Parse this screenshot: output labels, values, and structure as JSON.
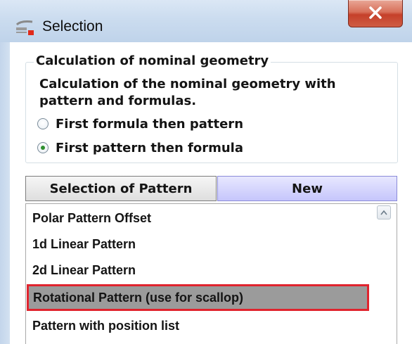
{
  "window": {
    "title": "Selection",
    "icon": "selection-app-icon",
    "close_icon": "close-icon"
  },
  "nominal_geometry": {
    "group_title": "Calculation of nominal geometry",
    "description_line1": "Calculation of the nominal geometry with",
    "description_line2": "pattern and formulas.",
    "options": [
      {
        "label": "First formula then pattern",
        "selected": false
      },
      {
        "label": "First pattern then formula",
        "selected": true
      }
    ]
  },
  "tabs": {
    "selection_label": "Selection of Pattern",
    "new_label": "New"
  },
  "pattern_list": {
    "items": [
      {
        "label": "Polar Pattern Offset",
        "selected": false
      },
      {
        "label": "1d Linear Pattern",
        "selected": false
      },
      {
        "label": "2d Linear Pattern",
        "selected": false
      },
      {
        "label": "Rotational Pattern (use for scallop)",
        "selected": true
      },
      {
        "label": "Pattern with position list",
        "selected": false
      }
    ],
    "scroll_icon": "scroll-up-arrow-icon"
  },
  "colors": {
    "selected_row_bg": "#9b9b9b",
    "highlight_border": "#e0242e",
    "new_tab_bg": "#c6c6fb",
    "close_button": "#c5402a"
  }
}
